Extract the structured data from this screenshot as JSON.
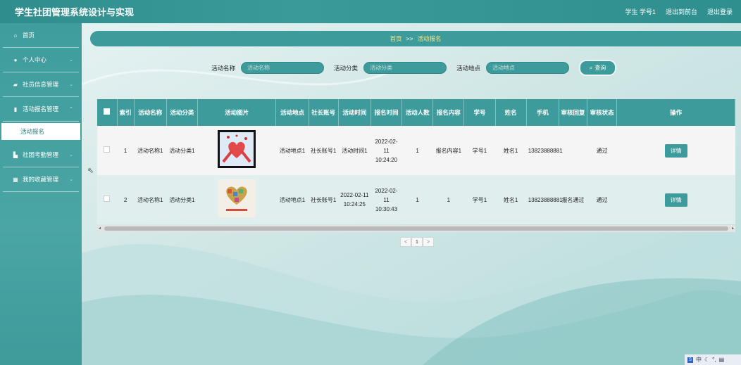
{
  "app": {
    "title": "学生社团管理系统设计与实现",
    "user_info": "学生 学号1",
    "back_link": "退出到前台",
    "logout_link": "退出登录"
  },
  "sidebar": {
    "items": [
      {
        "label": "首页",
        "icon": "home-icon"
      },
      {
        "label": "个人中心",
        "icon": "user-icon"
      },
      {
        "label": "社员信息管理",
        "icon": "id-card-icon"
      },
      {
        "label": "活动报名管理",
        "icon": "document-icon"
      },
      {
        "label": "社团考勤管理",
        "icon": "bar-chart-icon"
      },
      {
        "label": "我的收藏管理",
        "icon": "grid-icon"
      }
    ],
    "active_sub": "活动报名"
  },
  "breadcrumb": {
    "home": "首页",
    "separator": ">>",
    "current": "活动报名"
  },
  "search": {
    "name_label": "活动名称",
    "name_placeholder": "活动名称",
    "category_label": "活动分类",
    "category_placeholder": "活动分类",
    "place_label": "活动地点",
    "place_placeholder": "活动地点",
    "button_label": "查询"
  },
  "table": {
    "headers": [
      "索引",
      "活动名称",
      "活动分类",
      "活动图片",
      "活动地点",
      "社长账号",
      "活动时间",
      "报名时间",
      "活动人数",
      "报名内容",
      "学号",
      "姓名",
      "手机",
      "审核回复",
      "审核状态",
      "操作"
    ],
    "rows": [
      {
        "index": "1",
        "name": "活动名称1",
        "category": "活动分类1",
        "place": "活动地点1",
        "leader": "社长账号1",
        "act_time": "活动时间1",
        "reg_time": "2022-02-11 10:24:20",
        "count": "1",
        "content": "报名内容1",
        "sid": "学号1",
        "sname": "姓名1",
        "phone": "13823888881",
        "reply": "",
        "status": "通过",
        "action": "详情"
      },
      {
        "index": "2",
        "name": "活动名称1",
        "category": "活动分类1",
        "place": "活动地点1",
        "leader": "社长账号1",
        "act_time": "2022-02-11 10:24:25",
        "reg_time": "2022-02-11 10:30:43",
        "count": "1",
        "content": "1",
        "sid": "学号1",
        "sname": "姓名1",
        "phone": "13823888881",
        "reply": "报名通过",
        "status": "通过",
        "action": "详情"
      }
    ]
  },
  "pager": {
    "prev": "<",
    "current": "1",
    "next": ">"
  },
  "tray": {
    "ime": "中"
  },
  "colors": {
    "primary": "#3d9c9b",
    "breadcrumb_text": "#f7e58a"
  }
}
